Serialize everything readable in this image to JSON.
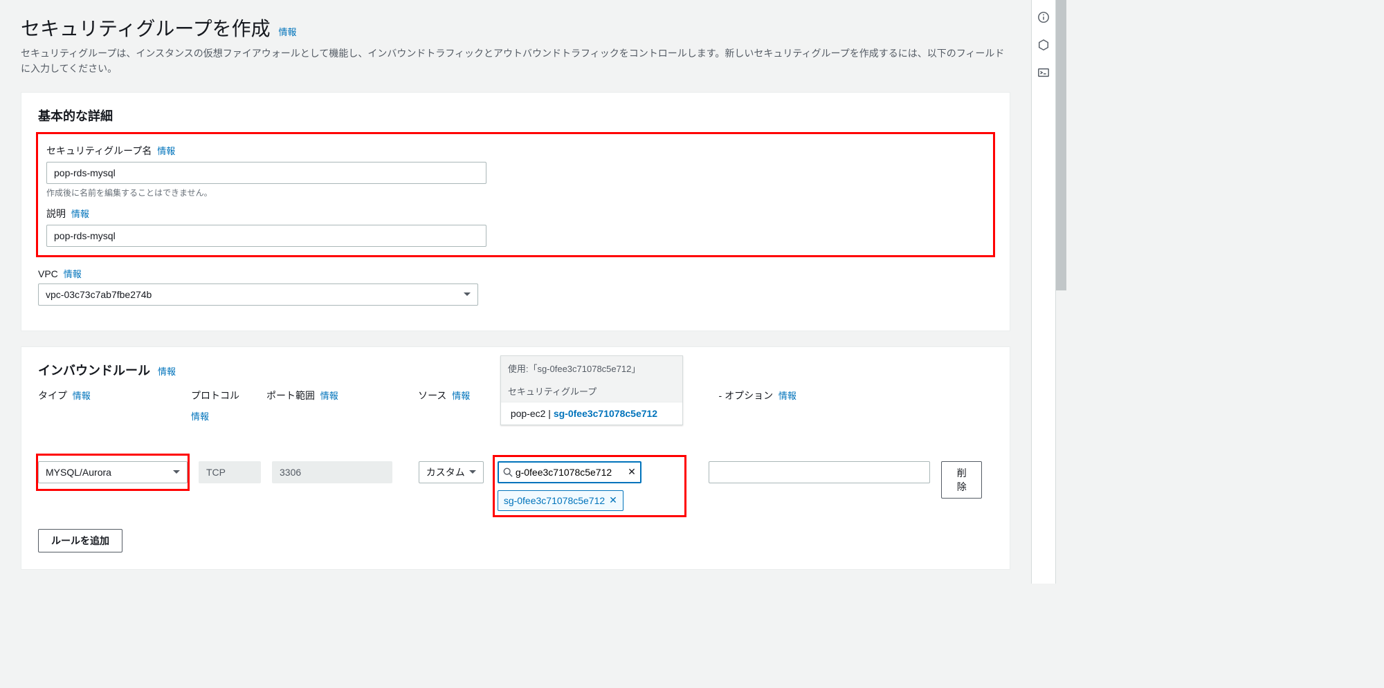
{
  "page": {
    "title": "セキュリティグループを作成",
    "info": "情報",
    "subtitle": "セキュリティグループは、インスタンスの仮想ファイアウォールとして機能し、インバウンドトラフィックとアウトバウンドトラフィックをコントロールします。新しいセキュリティグループを作成するには、以下のフィールドに入力してください。"
  },
  "basic": {
    "panel_title": "基本的な詳細",
    "sg_name_label": "セキュリティグループ名",
    "sg_name_value": "pop-rds-mysql",
    "sg_name_hint": "作成後に名前を編集することはできません。",
    "desc_label": "説明",
    "desc_value": "pop-rds-mysql",
    "vpc_label": "VPC",
    "vpc_value": "vpc-03c73c7ab7fbe274b"
  },
  "inbound": {
    "panel_title": "インバウンドルール",
    "cols": {
      "type": "タイプ",
      "protocol": "プロトコル",
      "port": "ポート範囲",
      "source": "ソース",
      "desc": "- オプション"
    },
    "row": {
      "type": "MYSQL/Aurora",
      "protocol": "TCP",
      "port": "3306",
      "source_mode": "カスタム",
      "source_search": "g-0fee3c71078c5e712",
      "source_tag": "sg-0fee3c71078c5e712",
      "delete": "削除"
    },
    "dropdown": {
      "in_use": "使用:「sg-0fee3c71078c5e712」",
      "heading": "セキュリティグループ",
      "item_name": "pop-ec2",
      "item_sep": " | ",
      "item_id": "sg-0fee3c71078c5e712"
    },
    "add_rule": "ルールを追加"
  }
}
